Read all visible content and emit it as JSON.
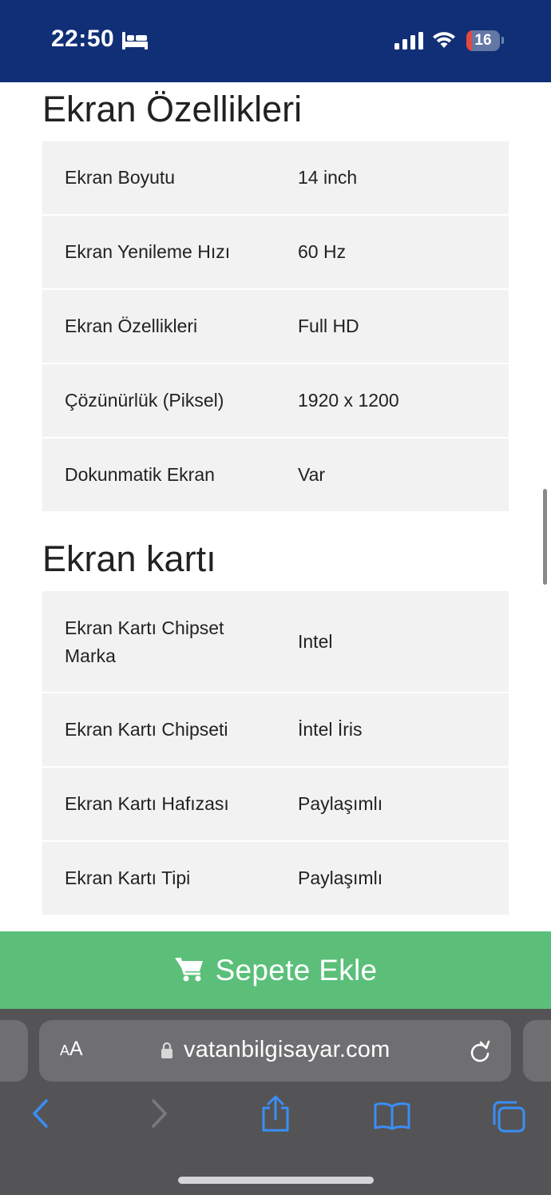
{
  "status_bar": {
    "time": "22:50",
    "battery_level": "16",
    "battery_fraction": 0.16,
    "icons": [
      "bed-icon",
      "cellular-signal-icon",
      "wifi-icon",
      "battery-icon"
    ]
  },
  "sections": [
    {
      "title": "Ekran Özellikleri",
      "rows": [
        {
          "key": "Ekran Boyutu",
          "value": "14 inch"
        },
        {
          "key": "Ekran Yenileme Hızı",
          "value": "60 Hz"
        },
        {
          "key": "Ekran Özellikleri",
          "value": "Full HD"
        },
        {
          "key": "Çözünürlük (Piksel)",
          "value": "1920 x 1200"
        },
        {
          "key": "Dokunmatik Ekran",
          "value": "Var"
        }
      ]
    },
    {
      "title": "Ekran kartı",
      "rows": [
        {
          "key": "Ekran Kartı Chipset Marka",
          "value": "Intel"
        },
        {
          "key": "Ekran Kartı Chipseti",
          "value": "İntel İris"
        },
        {
          "key": "Ekran Kartı Hafızası",
          "value": "Paylaşımlı"
        },
        {
          "key": "Ekran Kartı Tipi",
          "value": "Paylaşımlı"
        }
      ]
    }
  ],
  "cart_button": {
    "label": "Sepete Ekle",
    "icon": "cart-icon"
  },
  "browser": {
    "text_size_label_small": "A",
    "text_size_label_large": "A",
    "url": "vatanbilgisayar.com",
    "toolbar_icons": [
      "back-icon",
      "forward-icon",
      "share-icon",
      "bookmarks-icon",
      "tabs-icon"
    ]
  },
  "colors": {
    "status_bar_bg": "#102f76",
    "table_row_bg": "#f2f2f2",
    "cart_bar_bg": "#5bbf7a",
    "browser_bg": "#545456",
    "toolbar_accent": "#3a8ef6",
    "battery_low": "#e5483f"
  }
}
